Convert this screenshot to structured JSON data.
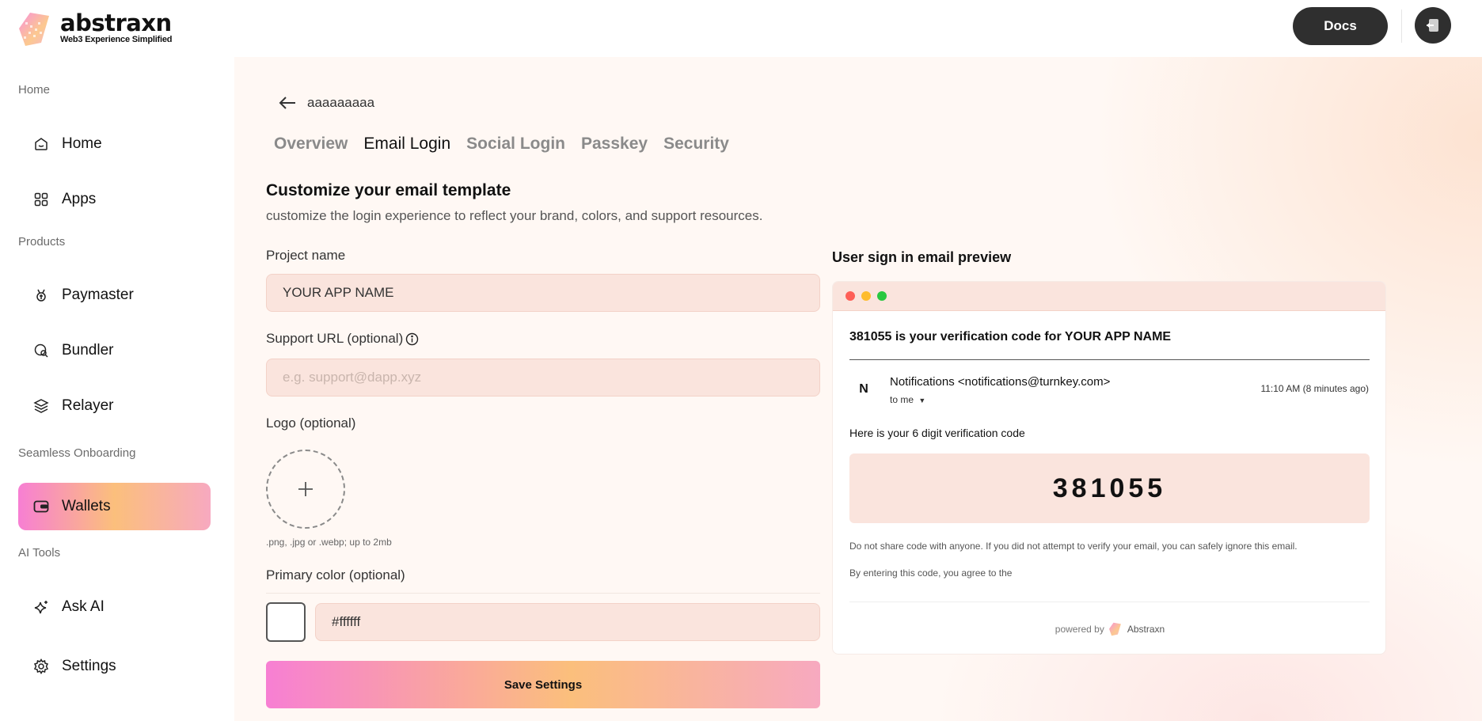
{
  "header": {
    "logo_name": "abstraxn",
    "logo_tagline": "Web3 Experience Simplified",
    "docs_label": "Docs"
  },
  "sidebar": {
    "sections": [
      {
        "label": "Home"
      },
      {
        "label": "Products"
      },
      {
        "label": "Seamless Onboarding"
      },
      {
        "label": "AI Tools"
      }
    ],
    "items": [
      {
        "label": "Home",
        "icon": "home-icon"
      },
      {
        "label": "Apps",
        "icon": "grid-icon"
      },
      {
        "label": "Paymaster",
        "icon": "paymaster-icon"
      },
      {
        "label": "Bundler",
        "icon": "bundler-icon"
      },
      {
        "label": "Relayer",
        "icon": "layers-icon"
      },
      {
        "label": "Wallets",
        "icon": "wallet-icon",
        "active": true
      },
      {
        "label": "Ask AI",
        "icon": "sparkle-icon"
      },
      {
        "label": "Settings",
        "icon": "gear-icon"
      }
    ]
  },
  "main": {
    "breadcrumb": "aaaaaaaaa",
    "tabs": [
      {
        "label": "Overview"
      },
      {
        "label": "Email Login",
        "active": true
      },
      {
        "label": "Social Login"
      },
      {
        "label": "Passkey"
      },
      {
        "label": "Security"
      }
    ],
    "title": "Customize your email template",
    "subtitle": "customize the login experience to reflect your brand, colors, and support resources.",
    "form": {
      "project_name_label": "Project name",
      "project_name_value": "YOUR APP NAME",
      "support_url_label": "Support URL (optional)",
      "support_url_placeholder": "e.g. support@dapp.xyz",
      "logo_label": "Logo (optional)",
      "logo_hint": ".png, .jpg or .webp; up to 2mb",
      "primary_color_label": "Primary color (optional)",
      "primary_color_value": "#ffffff",
      "save_label": "Save Settings"
    },
    "preview": {
      "title": "User sign in email preview",
      "subject": "381055 is your verification code for YOUR APP NAME",
      "sender_initial": "N",
      "sender": "Notifications <notifications@turnkey.com>",
      "to": "to me",
      "time": "11:10 AM (8 minutes ago)",
      "intro": "Here is your 6 digit verification code",
      "code": "381055",
      "disclaimer": "Do not share code with anyone. If you did not attempt to verify your email, you can safely ignore this email.",
      "agree": "By entering this code, you agree to the",
      "powered_by": "powered by",
      "brand": "Abstraxn"
    }
  },
  "colors": {
    "accent_gradient_start": "#f77fd3",
    "accent_gradient_mid": "#fbbf7c",
    "accent_gradient_end": "#f7a9c0",
    "input_bg": "#fae4dd",
    "dark_button": "#2f2f2f"
  }
}
